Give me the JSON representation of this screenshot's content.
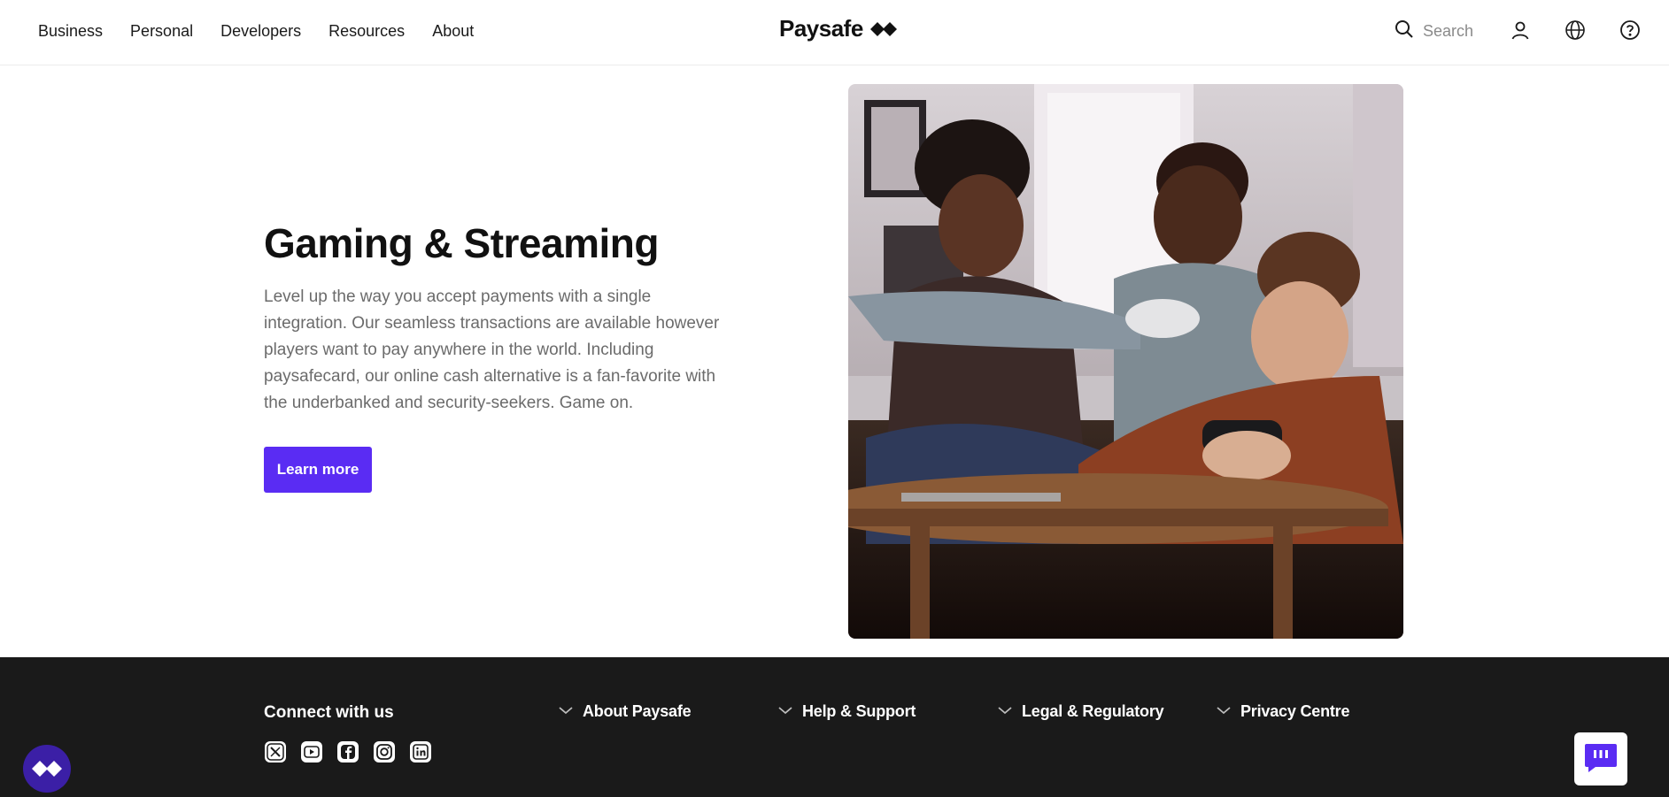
{
  "header": {
    "nav": [
      "Business",
      "Personal",
      "Developers",
      "Resources",
      "About"
    ],
    "logo_text": "Paysafe",
    "search_label": "Search",
    "icons": [
      "search-icon",
      "user-icon",
      "globe-icon",
      "help-icon"
    ]
  },
  "hero": {
    "title": "Gaming & Streaming",
    "description": "Level up the way you accept payments with a single integration. Our seamless transactions are available however players want to pay anywhere in the world. Including paysafecard, our online cash alternative is a fan-favorite with the underbanked and security-seekers. Game on.",
    "cta_label": "Learn more",
    "image": "photo of three young people laughing while playing video games on a couch",
    "cta_color": "#5a2cf3"
  },
  "footer": {
    "connect_title": "Connect with us",
    "socials": [
      "x-icon",
      "youtube-icon",
      "facebook-icon",
      "instagram-icon",
      "linkedin-icon"
    ],
    "links": [
      "About Paysafe",
      "Help & Support",
      "Legal & Regulatory",
      "Privacy Centre"
    ],
    "background": "#1a1a1a"
  },
  "widgets": {
    "float_logo": "paysafe-logo-icon",
    "chat": "chat-icon",
    "brand_color": "#5a2cf3"
  }
}
